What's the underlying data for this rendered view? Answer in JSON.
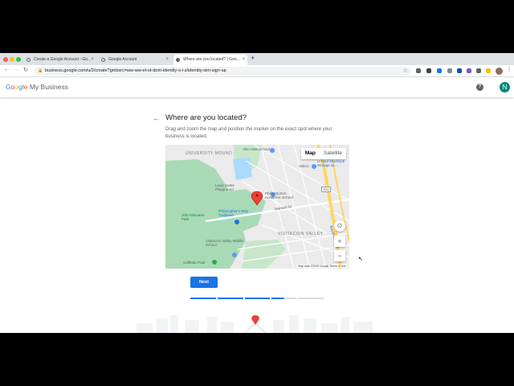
{
  "browser": {
    "tabs": [
      {
        "label": "Create a Google Account - Go..."
      },
      {
        "label": "Google Account"
      },
      {
        "label": "Where are you located? | Goo..."
      }
    ],
    "url": "business.google.com/u/2/create?gmbsrc=ww-ww-et-ot-dom-identity-s-i-z/identity-sim-sign-up"
  },
  "header": {
    "logo_google": [
      "G",
      "o",
      "o",
      "g",
      "l",
      "e"
    ],
    "logo_product": "My Business",
    "help_label": "?",
    "avatar_initial": "N"
  },
  "main": {
    "title": "Where are you located?",
    "description": "Drag and zoom the map and position the marker on the exact spot where your business is located.",
    "next_label": "Next",
    "progress_steps": 5,
    "progress_completed": 3.5
  },
  "map": {
    "type_options": [
      "Map",
      "Satellite"
    ],
    "selected_type": "Map",
    "labels": {
      "university_mound": "UNIVERSITY MOUND",
      "visitacion_valley": "VISITACION VALLEY",
      "alta_vista": "Alta Vista School",
      "louis_sutter": "Louis Sutter Playground",
      "philosophers_way": "Philosopher's Way Trailhead",
      "mclaren_park": "John McLaren Park",
      "visitacion_ms": "Visitacion Valley Middle School",
      "coffman_pool": "Coffman Pool",
      "burton_school": "Phillip Burton Academic School",
      "valero": "Valero",
      "uhaul": "U-Haul Moving & Storage at...",
      "mansell": "Mansell St",
      "bayshore": "Bayshore Blvd",
      "route": "101"
    },
    "footer": "Map data ©2020 Google   Terms of Use",
    "zoom_in": "+",
    "zoom_out": "−"
  },
  "colors": {
    "accent": "#1a73e8",
    "park": "#a8dab5",
    "water": "#aadaff",
    "highway": "#fdd663"
  }
}
